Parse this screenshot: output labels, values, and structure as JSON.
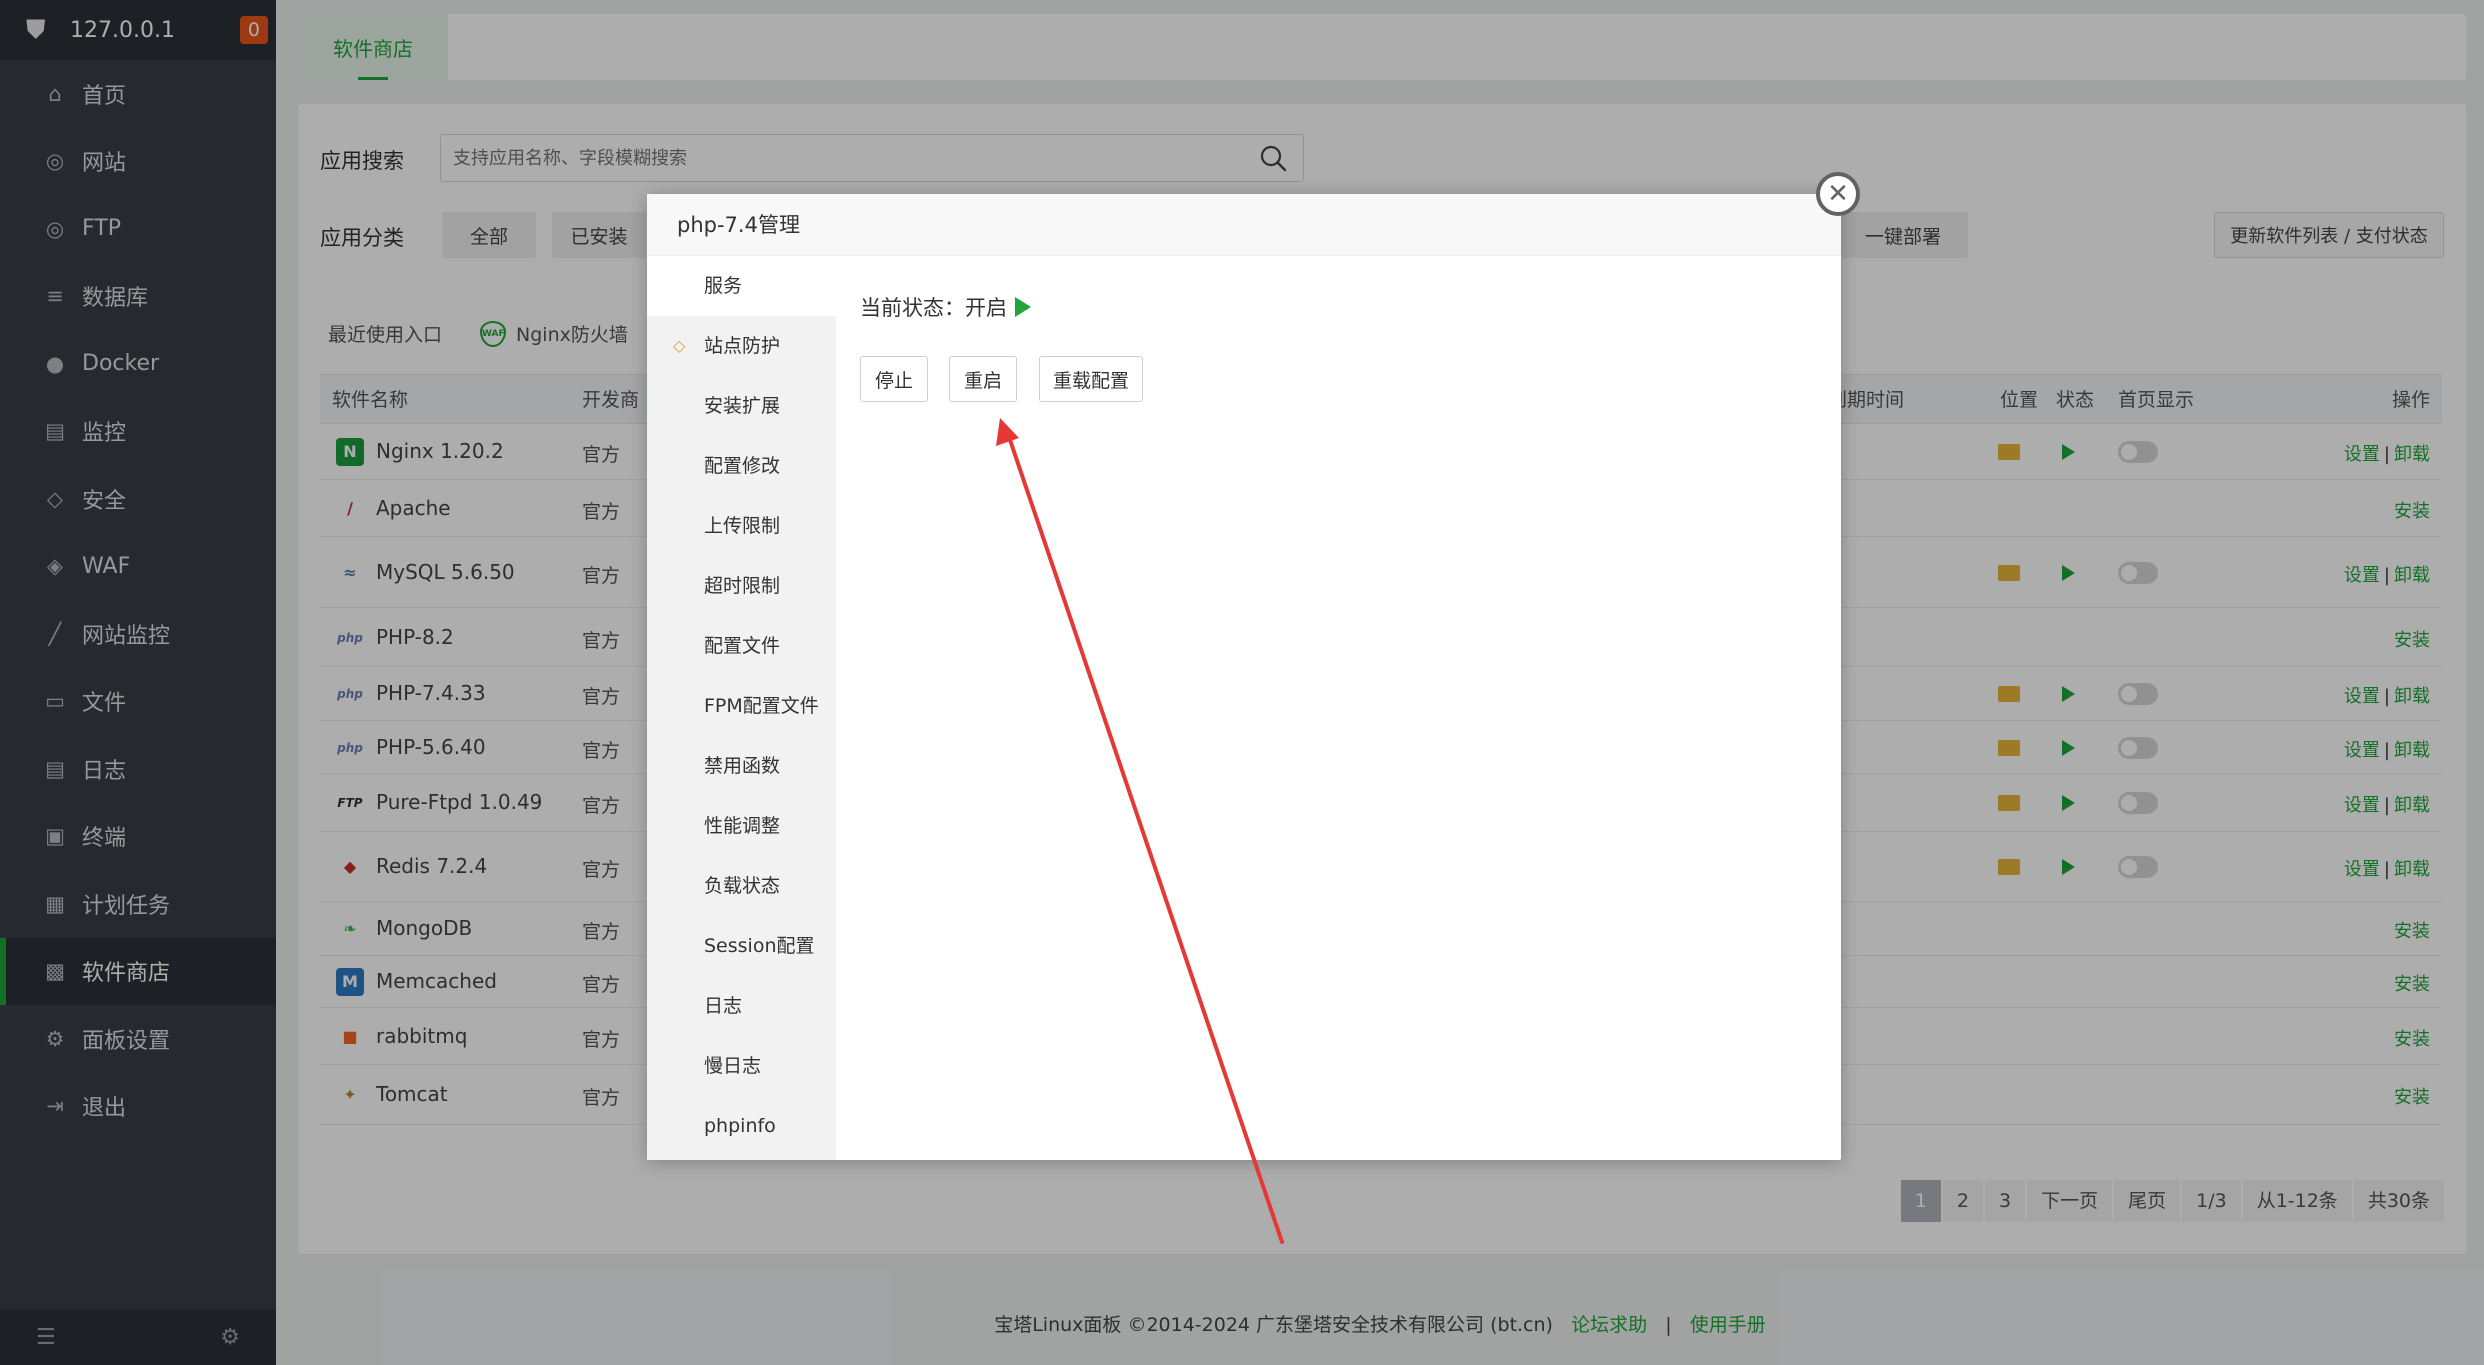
{
  "sidebar": {
    "host": "127.0.0.1",
    "badge": "0",
    "items": [
      {
        "label": "首页"
      },
      {
        "label": "网站"
      },
      {
        "label": "FTP"
      },
      {
        "label": "数据库"
      },
      {
        "label": "Docker"
      },
      {
        "label": "监控"
      },
      {
        "label": "安全"
      },
      {
        "label": "WAF"
      },
      {
        "label": "网站监控"
      },
      {
        "label": "文件"
      },
      {
        "label": "日志"
      },
      {
        "label": "终端"
      },
      {
        "label": "计划任务"
      },
      {
        "label": "软件商店"
      },
      {
        "label": "面板设置"
      },
      {
        "label": "退出"
      }
    ],
    "active_index": 13
  },
  "topbar": {
    "tab": "软件商店"
  },
  "main": {
    "search_label": "应用搜索",
    "search_placeholder": "支持应用名称、字段模糊搜索",
    "category_label": "应用分类",
    "categories": [
      "全部",
      "已安装"
    ],
    "deploy_button": "一键部署",
    "refresh_button": "更新软件列表 / 支付状态",
    "recent_label": "最近使用入口",
    "recent_app": "Nginx防火墙",
    "columns": {
      "name": "软件名称",
      "developer": "开发商",
      "expire": "到期时间",
      "location": "位置",
      "status": "状态",
      "homepage": "首页显示",
      "ops": "操作"
    },
    "rows": [
      {
        "name": "Nginx 1.20.2",
        "dev": "官方",
        "installed": true,
        "icon": "nginx-icon"
      },
      {
        "name": "Apache",
        "dev": "官方",
        "installed": false,
        "icon": "apache-feather-icon"
      },
      {
        "name": "MySQL 5.6.50",
        "dev": "官方",
        "installed": true,
        "icon": "mysql-dolphin-icon"
      },
      {
        "name": "PHP-8.2",
        "dev": "官方",
        "installed": false,
        "icon": "php-icon"
      },
      {
        "name": "PHP-7.4.33",
        "dev": "官方",
        "installed": true,
        "icon": "php-icon"
      },
      {
        "name": "PHP-5.6.40",
        "dev": "官方",
        "installed": true,
        "icon": "php-icon"
      },
      {
        "name": "Pure-Ftpd 1.0.49",
        "dev": "官方",
        "installed": true,
        "icon": "ftp-icon"
      },
      {
        "name": "Redis 7.2.4",
        "dev": "官方",
        "installed": true,
        "icon": "redis-icon"
      },
      {
        "name": "MongoDB",
        "dev": "官方",
        "installed": false,
        "icon": "mongodb-leaf-icon"
      },
      {
        "name": "Memcached",
        "dev": "官方",
        "installed": false,
        "icon": "memcached-icon"
      },
      {
        "name": "rabbitmq",
        "dev": "官方",
        "installed": false,
        "icon": "rabbitmq-icon"
      },
      {
        "name": "Tomcat",
        "dev": "官方",
        "installed": false,
        "icon": "tomcat-icon"
      }
    ],
    "op_settings": "设置",
    "op_uninstall": "卸载",
    "op_install": "安装",
    "pager": [
      "1",
      "2",
      "3",
      "下一页",
      "尾页",
      "1/3",
      "从1-12条",
      "共30条"
    ]
  },
  "footer": {
    "copyright": "宝塔Linux面板 ©2014-2024 广东堡塔安全技术有限公司 (bt.cn)",
    "forum": "论坛求助",
    "sep": "|",
    "manual": "使用手册"
  },
  "dialog": {
    "title": "php-7.4管理",
    "menu": [
      "服务",
      "站点防护",
      "安装扩展",
      "配置修改",
      "上传限制",
      "超时限制",
      "配置文件",
      "FPM配置文件",
      "禁用函数",
      "性能调整",
      "负载状态",
      "Session配置",
      "日志",
      "慢日志",
      "phpinfo"
    ],
    "status_label": "当前状态：开启",
    "buttons": [
      "停止",
      "重启",
      "重载配置"
    ]
  },
  "colors": {
    "accent": "#20a53a",
    "sidebar_bg": "#383d43",
    "annotation_arrow": "#e53935"
  }
}
